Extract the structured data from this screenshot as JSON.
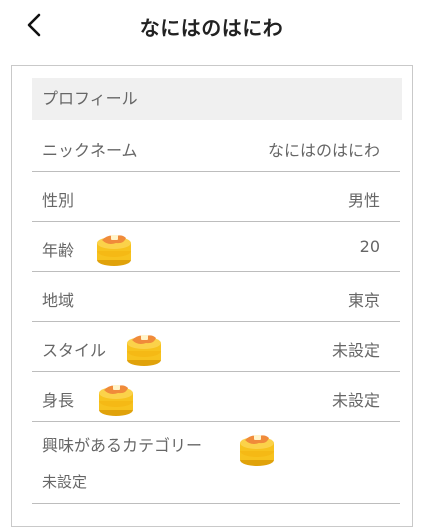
{
  "header": {
    "title": "なにはのはにわ"
  },
  "profile": {
    "section_title": "プロフィール",
    "rows": [
      {
        "label": "ニックネーム",
        "value": "なにはのはにわ",
        "has_pancake_icon": false
      },
      {
        "label": "性別",
        "value": "男性",
        "has_pancake_icon": false
      },
      {
        "label": "年齢",
        "value": "20",
        "has_pancake_icon": true
      },
      {
        "label": "地域",
        "value": "東京",
        "has_pancake_icon": false
      },
      {
        "label": "スタイル",
        "value": "未設定",
        "has_pancake_icon": true
      },
      {
        "label": "身長",
        "value": "未設定",
        "has_pancake_icon": true
      }
    ],
    "interests": {
      "label": "興味があるカテゴリー",
      "value": "未設定",
      "has_pancake_icon": true
    }
  },
  "colors": {
    "pancake": "#f7c21e",
    "pancake_dark": "#e0a20a",
    "topping": "#f08b3a",
    "divider": "#bdbdbd",
    "section_bg": "#f0f0f0",
    "text": "#666666"
  }
}
